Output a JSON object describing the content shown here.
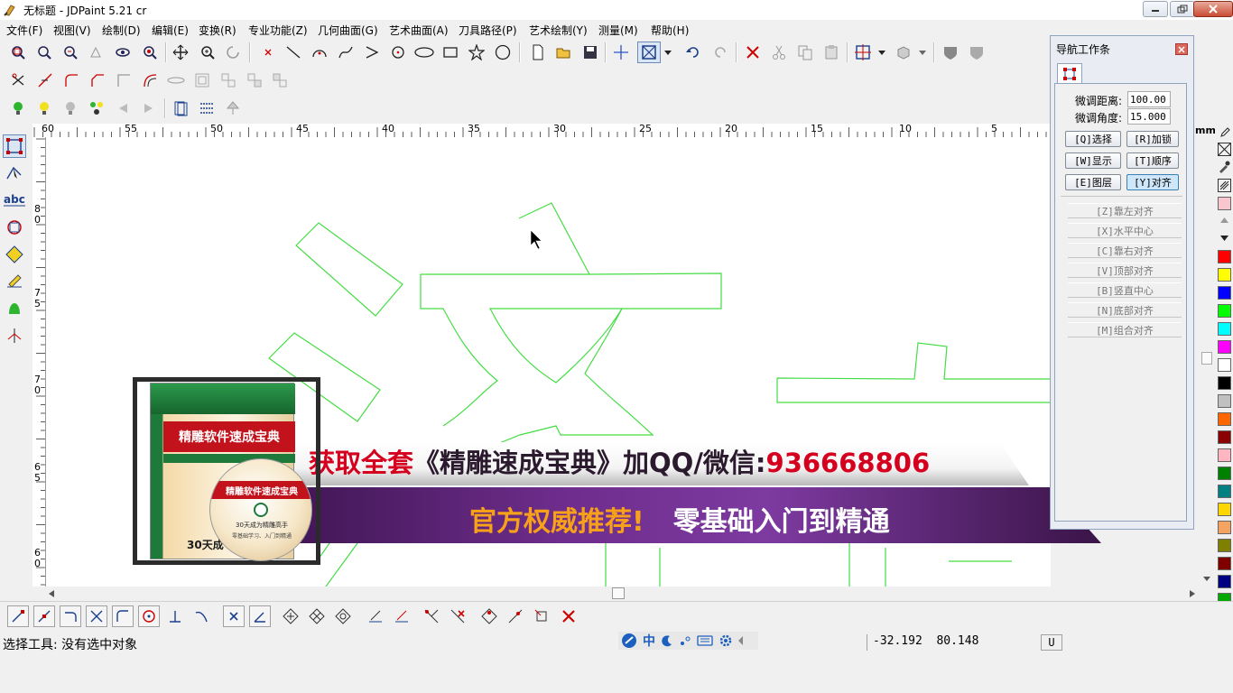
{
  "window": {
    "title": "无标题 - JDPaint 5.21 cr",
    "min_icon": "minimize-icon",
    "max_icon": "restore-icon",
    "close_icon": "close-icon"
  },
  "menu": [
    "文件(F)",
    "视图(V)",
    "绘制(D)",
    "编辑(E)",
    "变换(R)",
    "专业功能(Z)",
    "几何曲面(G)",
    "艺术曲面(A)",
    "刀具路径(P)",
    "艺术绘制(Y)",
    "测量(M)",
    "帮助(H)"
  ],
  "ruler": {
    "unit": "mm",
    "h_labels": [
      "60",
      "55",
      "50",
      "45",
      "40",
      "35",
      "30",
      "25",
      "20",
      "15",
      "10",
      "5"
    ],
    "v_labels": [
      "8\n0",
      "7\n5",
      "7\n0",
      "6\n5",
      "6\n0"
    ]
  },
  "nav_panel": {
    "title": "导航工作条",
    "fine_distance_label": "微调距离:",
    "fine_distance_value": "100.00",
    "fine_angle_label": "微调角度:",
    "fine_angle_value": "15.000",
    "buttons": [
      "[Q]选择",
      "[R]加锁",
      "[W]显示",
      "[T]顺序",
      "[E]图层",
      "[Y]对齐"
    ],
    "align_buttons": [
      "[Z]靠左对齐",
      "[X]水平中心",
      "[C]靠右对齐",
      "[V]顶部对齐",
      "[B]竖直中心",
      "[N]底部对齐",
      "[M]组合对齐"
    ]
  },
  "ad": {
    "box_title": "精雕软件速成宝典",
    "disc_title": "精雕软件速成宝典",
    "disc_sub": "30天成为精雕高手",
    "disc_sub2": "零基础学习、入门到精通",
    "box_bottom": "30天成",
    "line1_red": "获取全套",
    "line1_dark": "《精雕速成宝典》加QQ/微信:",
    "line1_number": "936668806",
    "line2_orange": "官方权威推荐!",
    "line2_white": "零基础入门到精通"
  },
  "status": {
    "message": "选择工具: 没有选中对象",
    "coords": "-32.192  80.148",
    "mode": "U",
    "ime_chinese": "中"
  },
  "palette": [
    "#ffff00",
    "#ff0000",
    "#ffff00",
    "#0000ff",
    "#00ff00",
    "#00ffff",
    "#ff00ff",
    "#ffffff",
    "#000000",
    "#c0c0c0",
    "#ff6600",
    "#8b0000",
    "#ffb6c1",
    "#008000",
    "#008080",
    "#ffd700",
    "#f4a460",
    "#808000",
    "#800000",
    "#000080",
    "#00aa00"
  ],
  "colors": {
    "title_bar": "#ffffff",
    "canvas": "#ffffff",
    "outline_green": "#44dd44",
    "ad_red": "#d4001e",
    "ad_orange": "#f7a11a"
  }
}
